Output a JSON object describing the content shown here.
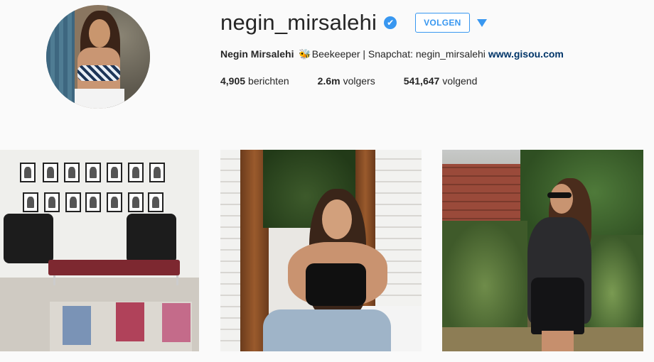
{
  "profile": {
    "username": "negin_mirsalehi",
    "verified_badge": "✔",
    "follow_label": "VOLGEN",
    "dropdown_icon": "dropdown-arrow-icon",
    "full_name": "Negin Mirsalehi",
    "bio_emoji": "🐝",
    "bio_text": "Beekeeper | Snapchat: negin_mirsalehi",
    "website": "www.gisou.com",
    "accent_color": "#3897f0"
  },
  "stats": [
    {
      "value": "4,905",
      "label": "berichten"
    },
    {
      "value": "2.6m",
      "label": "volgers"
    },
    {
      "value": "541,647",
      "label": "volgend"
    }
  ],
  "posts": [
    {
      "subject": "gallery lounge with framed portraits"
    },
    {
      "subject": "woman in black crop top smiling"
    },
    {
      "subject": "woman in black outfit among tropical plants"
    }
  ]
}
